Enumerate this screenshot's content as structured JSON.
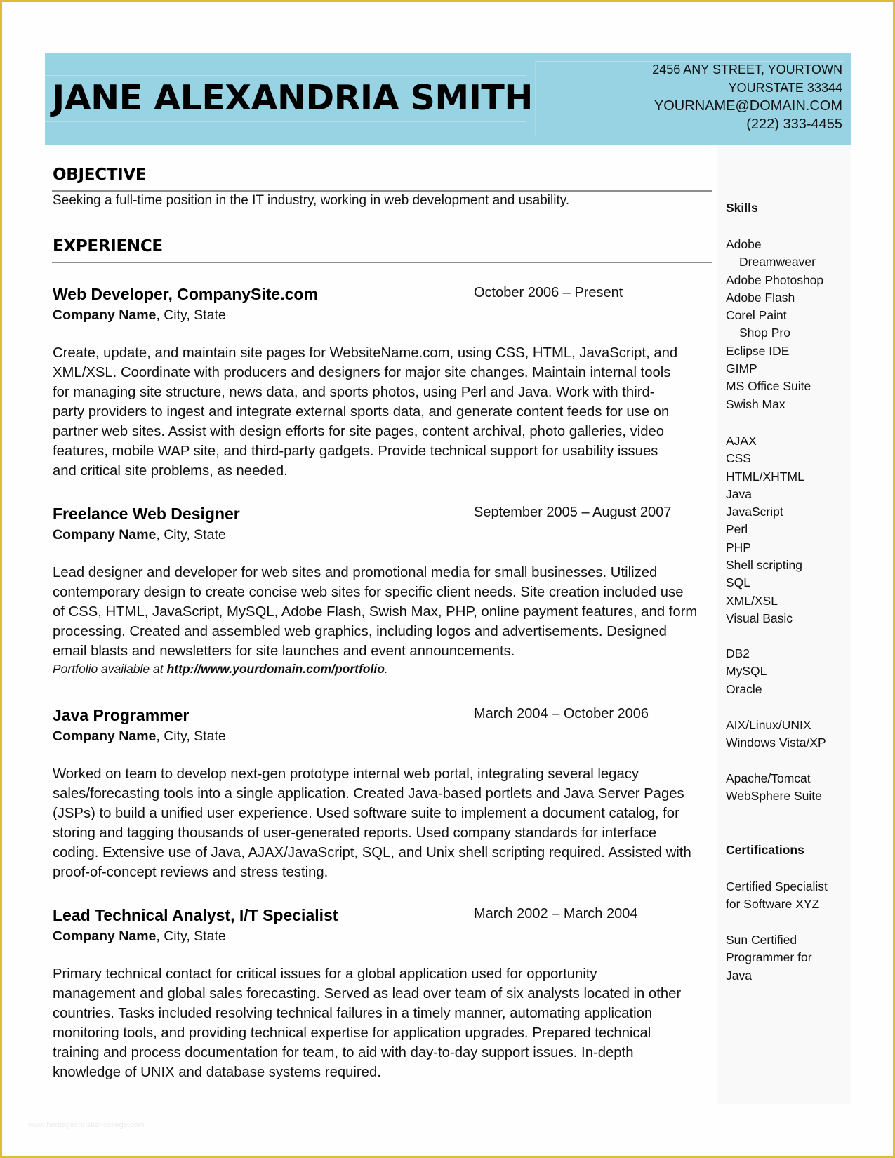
{
  "header": {
    "name": "JANE ALEXANDRIA SMITH",
    "contact": {
      "address_line1": "2456 ANY STREET, YOURTOWN",
      "address_line2": "YOURSTATE 33344",
      "email": "YOURNAME@DOMAIN.COM",
      "phone": "(222) 333-4455"
    },
    "band_color": "#98d3e3"
  },
  "objective": {
    "heading": "OBJECTIVE",
    "text": "Seeking a full-time position in the IT industry, working in web development and usability."
  },
  "experience": {
    "heading": "EXPERIENCE",
    "jobs": [
      {
        "title": "Web Developer, CompanySite.com",
        "dates": "October 2006 – Present",
        "company": "Company Name",
        "location": ", City, State",
        "description_lines": [
          "Create, update, and maintain site pages for WebsiteName.com, using CSS, HTML, JavaScript, and",
          "XML/XSL. Coordinate with producers and designers for major site changes. Maintain internal tools",
          "for managing site structure, news data, and sports photos, using Perl and Java. Work with third-",
          "party providers to ingest and integrate external sports data, and generate content feeds for use on",
          "partner web sites. Assist with design efforts for site pages, content archival, photo galleries, video",
          "features, mobile WAP site, and third-party gadgets. Provide technical support for usability issues",
          "and critical site problems, as needed."
        ]
      },
      {
        "title": "Freelance Web Designer",
        "dates": "September 2005 – August 2007",
        "company": "Company Name",
        "location": ", City, State",
        "description_lines": [
          "Lead designer and developer for web sites and promotional media for small businesses. Utilized",
          "contemporary design to create concise web sites for specific client needs. Site creation included use",
          "of CSS, HTML, JavaScript, MySQL, Adobe Flash, Swish Max, PHP, online payment features, and form",
          "processing. Created and assembled web graphics, including logos and advertisements. Designed",
          "email blasts and newsletters for site launches and event announcements."
        ],
        "portfolio": {
          "prefix": "Portfolio available at ",
          "url": "http://www.yourdomain.com/portfolio",
          "suffix": "."
        }
      },
      {
        "title": "Java Programmer",
        "dates": "March 2004 – October 2006",
        "company": "Company Name",
        "location": ", City, State",
        "description_lines": [
          "Worked on team to develop next-gen prototype internal web portal, integrating several legacy",
          "sales/forecasting tools into a single application. Created Java-based portlets and Java Server Pages",
          "(JSPs) to build a unified user experience. Used software suite to implement a document catalog, for",
          "storing and tagging thousands of user-generated reports. Used company standards for interface",
          "coding. Extensive use of Java,  AJAX/JavaScript, SQL, and Unix shell scripting required. Assisted with",
          "proof-of-concept reviews and stress testing."
        ]
      },
      {
        "title": "Lead Technical Analyst, I/T Specialist",
        "dates": "March 2002 – March 2004",
        "company": "Company Name",
        "location": ", City, State",
        "description_lines": [
          "Primary technical contact for critical issues for a global application used for opportunity",
          "management and global sales forecasting. Served as lead over team of six analysts located in other",
          "countries. Tasks included resolving technical failures in a timely manner, automating application",
          "monitoring tools, and providing technical expertise for application upgrades. Prepared technical",
          "training and process documentation for team, to aid with day-to-day support issues. In-depth",
          "knowledge of UNIX and database systems required."
        ]
      }
    ]
  },
  "sidebar": {
    "skills_heading": "Skills",
    "skill_groups": [
      [
        {
          "text": "Adobe",
          "indent": false
        },
        {
          "text": "Dreamweaver",
          "indent": true
        },
        {
          "text": "Adobe Photoshop",
          "indent": false
        },
        {
          "text": "Adobe Flash",
          "indent": false
        },
        {
          "text": "Corel Paint",
          "indent": false
        },
        {
          "text": "Shop Pro",
          "indent": true
        },
        {
          "text": "Eclipse IDE",
          "indent": false
        },
        {
          "text": "GIMP",
          "indent": false
        },
        {
          "text": "MS Office Suite",
          "indent": false
        },
        {
          "text": "Swish Max",
          "indent": false
        }
      ],
      [
        {
          "text": "AJAX",
          "indent": false
        },
        {
          "text": "CSS",
          "indent": false
        },
        {
          "text": "HTML/XHTML",
          "indent": false
        },
        {
          "text": "Java",
          "indent": false
        },
        {
          "text": "JavaScript",
          "indent": false
        },
        {
          "text": "Perl",
          "indent": false
        },
        {
          "text": "PHP",
          "indent": false
        },
        {
          "text": "Shell scripting",
          "indent": false
        },
        {
          "text": "SQL",
          "indent": false
        },
        {
          "text": "XML/XSL",
          "indent": false
        },
        {
          "text": "Visual Basic",
          "indent": false
        }
      ],
      [
        {
          "text": "DB2",
          "indent": false
        },
        {
          "text": "MySQL",
          "indent": false
        },
        {
          "text": "Oracle",
          "indent": false
        }
      ],
      [
        {
          "text": "AIX/Linux/UNIX",
          "indent": false
        },
        {
          "text": "Windows Vista/XP",
          "indent": false
        }
      ],
      [
        {
          "text": "Apache/Tomcat",
          "indent": false
        },
        {
          "text": "WebSphere Suite",
          "indent": false
        }
      ]
    ],
    "certifications_heading": "Certifications",
    "certifications": [
      [
        "Certified Specialist",
        "for Software XYZ"
      ],
      [
        "Sun Certified",
        "Programmer for",
        "Java"
      ]
    ]
  },
  "watermark": "www.heritagechristiancollege.com"
}
